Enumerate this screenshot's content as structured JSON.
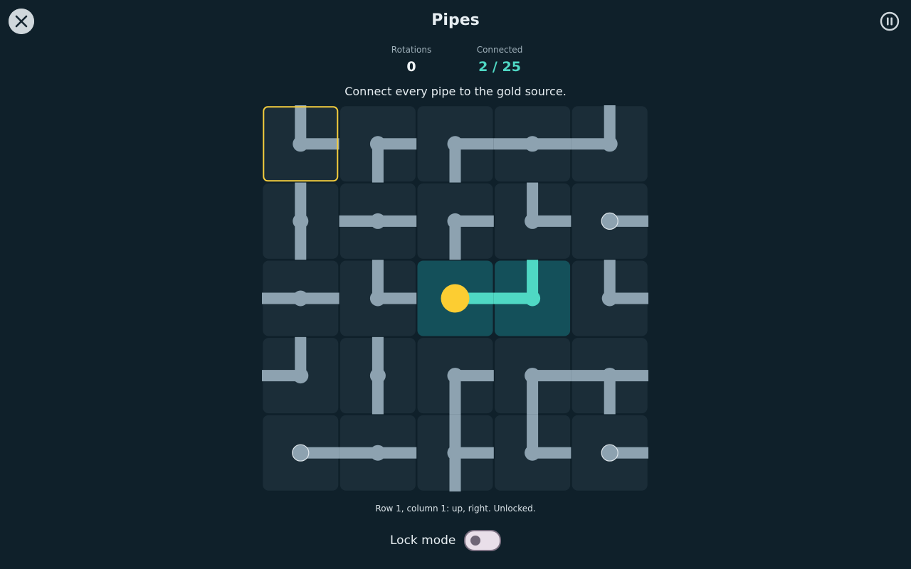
{
  "app": {
    "title": "Pipes"
  },
  "header": {
    "close_icon": "close-icon",
    "pause_icon": "pause-icon"
  },
  "stats": {
    "rotations_label": "Rotations",
    "rotations_value": "0",
    "connected_label": "Connected",
    "connected_value": "2 / 25"
  },
  "instruction": "Connect every pipe to the gold source.",
  "board": {
    "rows": 5,
    "cols": 5,
    "selected": [
      0,
      0
    ],
    "source": [
      2,
      2
    ],
    "tiles": [
      [
        {
          "dirs": [
            "up",
            "right"
          ],
          "connected": false
        },
        {
          "dirs": [
            "right",
            "down"
          ],
          "connected": false
        },
        {
          "dirs": [
            "right",
            "down"
          ],
          "connected": false
        },
        {
          "dirs": [
            "left",
            "right"
          ],
          "connected": false
        },
        {
          "dirs": [
            "up",
            "left"
          ],
          "connected": false
        }
      ],
      [
        {
          "dirs": [
            "up",
            "down"
          ],
          "connected": false
        },
        {
          "dirs": [
            "left",
            "right"
          ],
          "connected": false
        },
        {
          "dirs": [
            "right",
            "down"
          ],
          "connected": false
        },
        {
          "dirs": [
            "up",
            "right"
          ],
          "connected": false
        },
        {
          "dirs": [
            "right"
          ],
          "connected": false
        }
      ],
      [
        {
          "dirs": [
            "left",
            "right"
          ],
          "connected": false
        },
        {
          "dirs": [
            "up",
            "right"
          ],
          "connected": false
        },
        {
          "dirs": [
            "right"
          ],
          "connected": true
        },
        {
          "dirs": [
            "up",
            "left"
          ],
          "connected": true
        },
        {
          "dirs": [
            "up",
            "right"
          ],
          "connected": false
        }
      ],
      [
        {
          "dirs": [
            "up",
            "left"
          ],
          "connected": false
        },
        {
          "dirs": [
            "up",
            "down"
          ],
          "connected": false
        },
        {
          "dirs": [
            "right",
            "down"
          ],
          "connected": false
        },
        {
          "dirs": [
            "right",
            "down"
          ],
          "connected": false
        },
        {
          "dirs": [
            "left",
            "right",
            "down"
          ],
          "connected": false
        }
      ],
      [
        {
          "dirs": [
            "right"
          ],
          "connected": false
        },
        {
          "dirs": [
            "left",
            "right"
          ],
          "connected": false
        },
        {
          "dirs": [
            "up",
            "right",
            "down"
          ],
          "connected": false
        },
        {
          "dirs": [
            "up",
            "right"
          ],
          "connected": false
        },
        {
          "dirs": [
            "right"
          ],
          "connected": false
        }
      ]
    ],
    "colors": {
      "tile": "#1b2d38",
      "tile_connected": "#14505a",
      "pipe": "#8da2b0",
      "pipe_connected": "#4fd8c4",
      "source": "#fccd32",
      "selection": "#f5cd3d"
    }
  },
  "status_text": "Row 1, column 1: up, right. Unlocked.",
  "lock_mode": {
    "label": "Lock mode",
    "on": false
  }
}
